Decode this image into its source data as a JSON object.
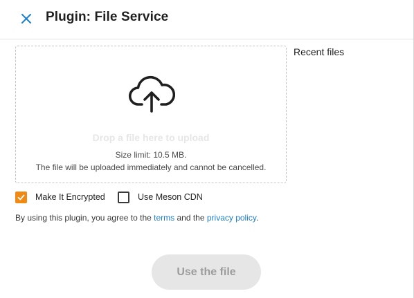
{
  "header": {
    "title": "Plugin: File Service",
    "close_icon": "close-icon"
  },
  "dropzone": {
    "icon": "cloud-upload-icon",
    "hint": "Drop a file here to upload",
    "size_limit": "Size limit: 10.5 MB.",
    "note": "The file will be uploaded immediately and cannot be cancelled."
  },
  "sidebar": {
    "recent_files_label": "Recent files"
  },
  "options": {
    "encrypted": {
      "label": "Make It Encrypted",
      "checked": true
    },
    "cdn": {
      "label": "Use Meson CDN",
      "checked": false
    }
  },
  "terms": {
    "prefix": "By using this plugin, you agree to the ",
    "terms_link": "terms",
    "middle": " and the ",
    "privacy_link": "privacy policy",
    "suffix": "."
  },
  "footer": {
    "use_button_label": "Use the file",
    "use_button_enabled": false
  },
  "colors": {
    "accent": "#1a7fd4",
    "checkbox_checked": "#f08a14",
    "button_disabled_bg": "#e6e6e6",
    "button_disabled_text": "#9c9c9c"
  }
}
